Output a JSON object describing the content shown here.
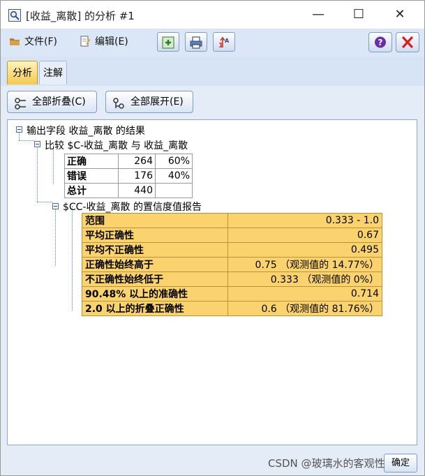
{
  "window": {
    "title": "[收益_离散] 的分析 #1",
    "controls": {
      "minimize": "—",
      "maximize": "☐",
      "close": "✕"
    }
  },
  "toolbar": {
    "file_label": "文件(F)",
    "edit_label": "编辑(E)",
    "icons": [
      "export-icon",
      "print-icon",
      "sort-icon"
    ],
    "help_label": "?",
    "close_label": "✕"
  },
  "tabs": [
    {
      "label": "分析",
      "active": true
    },
    {
      "label": "注解",
      "active": false
    }
  ],
  "actions": {
    "collapse_all": "全部折叠(C)",
    "expand_all": "全部展开(E)"
  },
  "tree": {
    "root": "输出字段 收益_离散 的结果",
    "compare_node": "比较 $C-收益_离散 与 收益_离散",
    "compare_table": [
      {
        "label": "正确",
        "count": "264",
        "pct": "60%"
      },
      {
        "label": "错误",
        "count": "176",
        "pct": "40%"
      },
      {
        "label": "总计",
        "count": "440",
        "pct": ""
      }
    ],
    "confidence_node": "$CC-收益_离散 的置信度值报告",
    "confidence_table": [
      {
        "label": "范围",
        "value": "0.333 - 1.0"
      },
      {
        "label": "平均正确性",
        "value": "0.67"
      },
      {
        "label": "平均不正确性",
        "value": "0.495"
      },
      {
        "label": "正确性始终高于",
        "value": "0.75 （观测值的 14.77%）"
      },
      {
        "label": "不正确性始终低于",
        "value": "0.333 （观测值的 0%）"
      },
      {
        "label": "90.48% 以上的准确性",
        "value": "0.714"
      },
      {
        "label": "2.0 以上的折叠正确性",
        "value": "0.6 （观测值的 81.76%）"
      }
    ]
  },
  "footer": {
    "button_label": "确定",
    "watermark": "CSDN @玻璃水的客观性"
  },
  "colors": {
    "toolbar_bg": "#dbe7f6",
    "active_tab": "#f3c94e",
    "confidence_table_bg": "#fbd36e"
  }
}
